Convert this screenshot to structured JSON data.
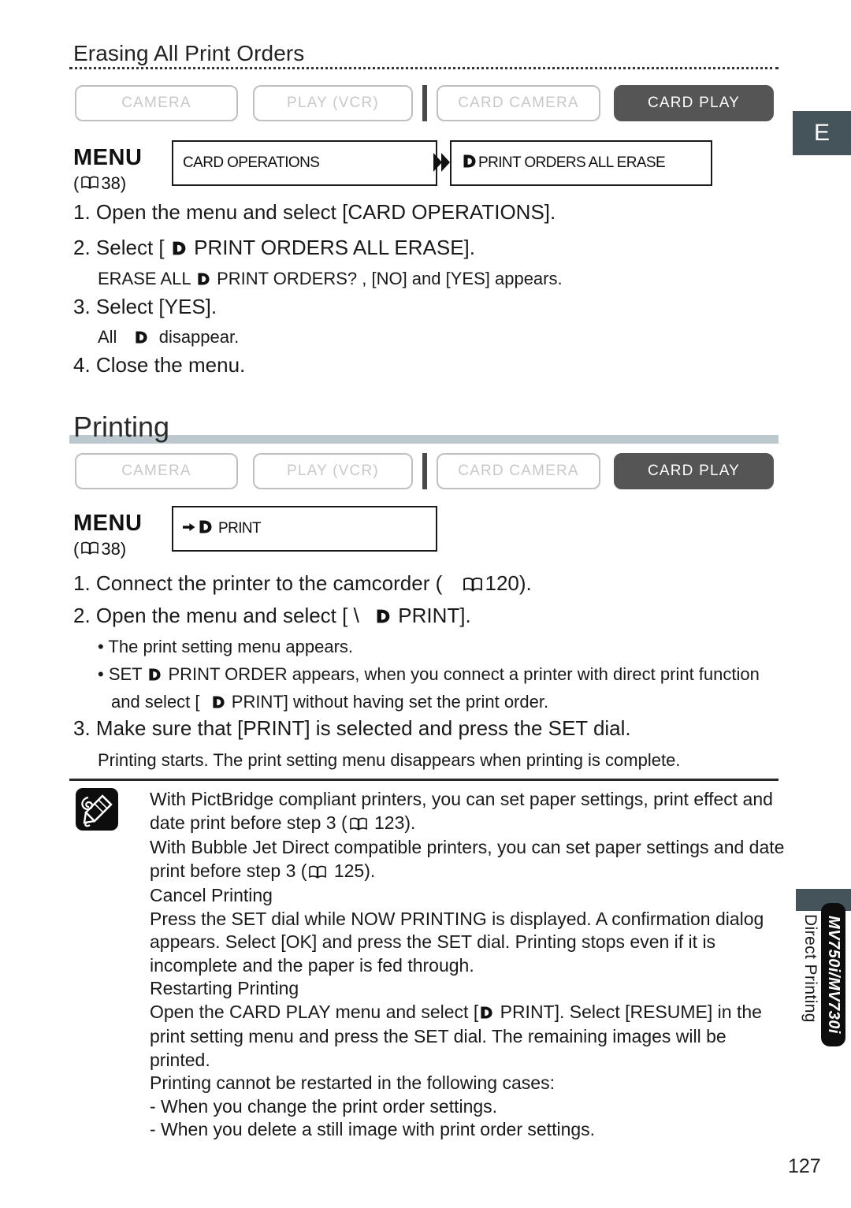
{
  "page": {
    "number": "127",
    "language_tab": "E"
  },
  "colors": {
    "active_button": "#555555",
    "inactive_button_border": "#c0c0c0",
    "inactive_button_text": "#c8c8c8",
    "heading_bar": "#bcc8ce",
    "side_tab": "#45535b",
    "badge": "#0d0d0d"
  },
  "section1": {
    "heading": "Erasing All Print Orders",
    "modes": [
      {
        "label": "CAMERA",
        "active": false
      },
      {
        "label": "PLAY (VCR)",
        "active": false
      },
      {
        "label": "CARD CAMERA",
        "active": false
      },
      {
        "label": "CARD PLAY",
        "active": true
      }
    ],
    "menu": {
      "word": "MENU",
      "ref_page": "38",
      "box1": "CARD OPERATIONS",
      "box2": "PRINT ORDERS ALL ERASE",
      "arrow": "▶"
    },
    "steps": [
      {
        "num": "1.",
        "text": "Open the menu and select [CARD OPERATIONS]."
      },
      {
        "num": "2.",
        "text_before": "Select [",
        "text_after": "PRINT ORDERS ALL ERASE]."
      },
      {
        "num": "3.",
        "text": "Select [YES]."
      },
      {
        "num": "4.",
        "text": "Close the menu."
      }
    ],
    "note_after_step2_before": "ERASE ALL",
    "note_after_step2_after": "PRINT ORDERS? , [NO] and [YES] appears.",
    "note_after_step3_before": "All",
    "note_after_step3_after": "disappear."
  },
  "section2": {
    "heading": "Printing",
    "modes": [
      {
        "label": "CAMERA",
        "active": false
      },
      {
        "label": "PLAY (VCR)",
        "active": false
      },
      {
        "label": "CARD CAMERA",
        "active": false
      },
      {
        "label": "CARD PLAY",
        "active": true
      }
    ],
    "menu": {
      "word": "MENU",
      "ref_page": "38",
      "box1": "PRINT",
      "box1_prefix_arrow": "➡"
    },
    "step1_before": "Connect the printer to the camcorder (",
    "step1_ref": "120",
    "step1_after": ").",
    "step2_before": "Open the menu and select [ \\",
    "step2_after": "PRINT].",
    "step2_bullets": [
      {
        "marker": "•",
        "text": "The print setting menu appears."
      }
    ],
    "step2_bullet2_a": "SET",
    "step2_bullet2_b": "PRINT ORDER  appears, when you connect a printer with direct print function",
    "step2_bullet2_c_before": "and select [",
    "step2_bullet2_c_after": "PRINT] without having set the print order.",
    "step3": "Make sure that [PRINT] is selected and press the SET dial.",
    "step3_note": "Printing starts. The print setting menu disappears when printing is complete."
  },
  "notes": {
    "icon": "note-pencil-icon",
    "lines": [
      {
        "type": "text",
        "text": "With PictBridge compliant printers, you can set paper settings, print effect and"
      },
      {
        "type": "ref",
        "before": "date print before step 3 (",
        "ref": "123",
        "after": ")."
      },
      {
        "type": "text",
        "text": "With Bubble Jet Direct compatible printers, you can set paper settings and date"
      },
      {
        "type": "ref",
        "before": "print before step 3 (",
        "ref": "125",
        "after": ")."
      },
      {
        "type": "text",
        "text": "Cancel Printing"
      },
      {
        "type": "text",
        "text": "Press the SET dial while  NOW PRINTING  is displayed. A confirmation dialog"
      },
      {
        "type": "text",
        "text": "appears. Select [OK] and press the SET dial. Printing stops even if it is"
      },
      {
        "type": "text",
        "text": "incomplete and the paper is fed through."
      },
      {
        "type": "text",
        "text": "Restarting Printing"
      },
      {
        "type": "print",
        "before": "Open the CARD PLAY menu and select [",
        "after": "PRINT]. Select [RESUME] in the"
      },
      {
        "type": "text",
        "text": "print setting menu and press the SET dial. The remaining images will be"
      },
      {
        "type": "text",
        "text": "printed."
      },
      {
        "type": "text",
        "text": "Printing cannot be restarted in the following cases:"
      },
      {
        "type": "text",
        "text": "-  When you change the print order settings."
      },
      {
        "type": "text",
        "text": "-  When you delete a still image with print order settings."
      }
    ]
  },
  "side_tab": {
    "label": "Direct Printing",
    "model_badge": "MV750i/MV730i"
  }
}
